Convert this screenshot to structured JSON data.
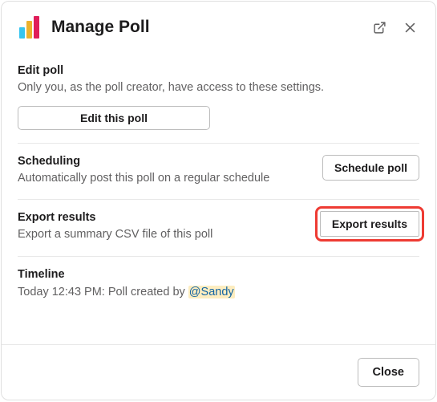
{
  "header": {
    "title": "Manage Poll"
  },
  "editPoll": {
    "title": "Edit poll",
    "desc": "Only you, as the poll creator, have access to these settings.",
    "button": "Edit this poll"
  },
  "scheduling": {
    "title": "Scheduling",
    "desc": "Automatically post this poll on a regular schedule",
    "button": "Schedule poll"
  },
  "exportResults": {
    "title": "Export results",
    "desc": "Export a summary CSV file of this poll",
    "button": "Export results"
  },
  "timeline": {
    "title": "Timeline",
    "entryPrefix": "Today 12:43 PM: Poll created by ",
    "mention": "@Sandy"
  },
  "footer": {
    "close": "Close"
  }
}
